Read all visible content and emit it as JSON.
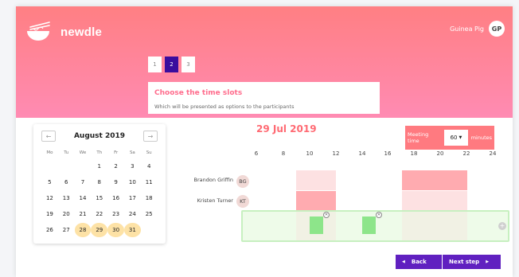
{
  "app": {
    "name": "newdle"
  },
  "user": {
    "name": "Guinea Pig",
    "initials": "GP"
  },
  "steps": [
    {
      "label": "1",
      "active": false
    },
    {
      "label": "2",
      "active": true
    },
    {
      "label": "3",
      "active": false
    }
  ],
  "panel": {
    "title": "Choose the time slots",
    "subtitle": "Which will be presented as options to the participants"
  },
  "calendar": {
    "month_label": "August 2019",
    "prev_label": "←",
    "next_label": "→",
    "dow": [
      "Mo",
      "Tu",
      "We",
      "Th",
      "Fr",
      "Sa",
      "Su"
    ],
    "weeks": [
      [
        "",
        "",
        "",
        "1",
        "2",
        "3",
        "4"
      ],
      [
        "5",
        "6",
        "7",
        "8",
        "9",
        "10",
        "11"
      ],
      [
        "12",
        "13",
        "14",
        "15",
        "16",
        "17",
        "18"
      ],
      [
        "19",
        "20",
        "21",
        "22",
        "23",
        "24",
        "25"
      ],
      [
        "26",
        "27",
        "28",
        "29",
        "30",
        "31",
        ""
      ]
    ],
    "selected": [
      "28",
      "29",
      "30",
      "31"
    ]
  },
  "date_title": "29 Jul 2019",
  "meeting_time": {
    "label": "Meeting time",
    "value": "60",
    "unit": "minutes"
  },
  "timeline": {
    "hours": [
      "6",
      "8",
      "10",
      "12",
      "14",
      "16",
      "18",
      "20",
      "22",
      "24"
    ],
    "participants": [
      {
        "name": "Brandon Griffin",
        "initials": "BG"
      },
      {
        "name": "Kristen Turner",
        "initials": "KT"
      }
    ]
  },
  "buttons": {
    "back_label": "Back",
    "next_label": "Next step"
  },
  "colors": {
    "accent": "#6020c0",
    "brand_pink": "#ff7f83",
    "selected_day": "#fde2a6",
    "slot_green": "#8de58a"
  }
}
